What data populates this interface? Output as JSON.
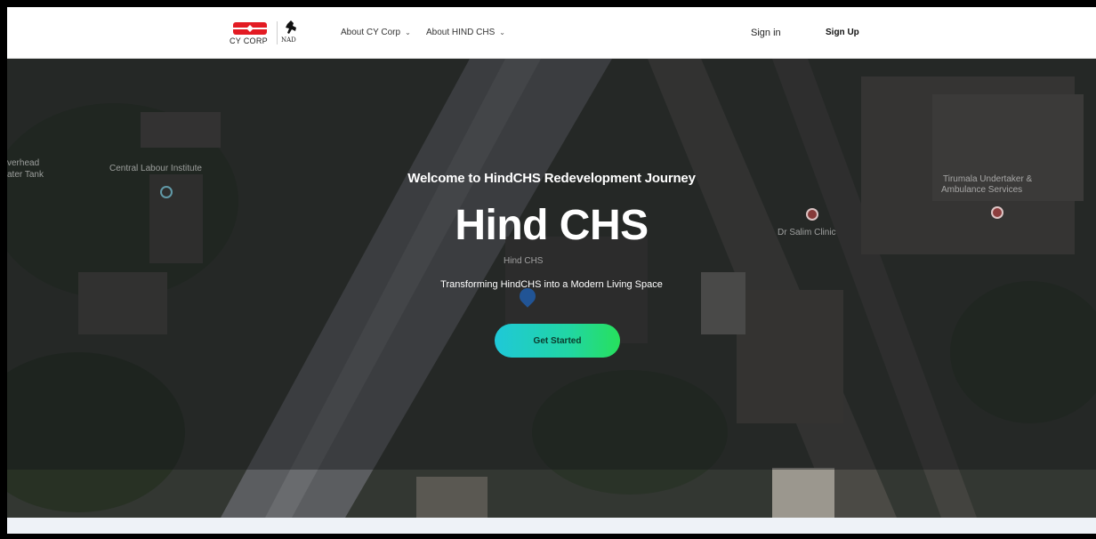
{
  "header": {
    "logo_cy_text": "CY CORP",
    "logo_nad_text": "NAD",
    "nav": [
      {
        "label": "About CY Corp",
        "chevron": "⌄"
      },
      {
        "label": "About HIND CHS",
        "chevron": "⌄"
      }
    ],
    "sign_in": "Sign in",
    "sign_up": "Sign Up"
  },
  "hero": {
    "welcome": "Welcome to HindCHS Redevelopment Journey",
    "title": "Hind CHS",
    "subtitle": "Transforming HindCHS into a Modern Living Space",
    "cta": "Get Started",
    "map_labels": {
      "central_labour": "Central Labour Institute",
      "overhead_1": "verhead",
      "overhead_2": "ater Tank",
      "hind_chs": "Hind CHS",
      "dr_salim": "Dr Salim Clinic",
      "tirumala_1": "Tirumala Undertaker &",
      "tirumala_2": "Ambulance Services"
    }
  },
  "colors": {
    "brand_red": "#e31b23",
    "cta_start": "#1fc8d8",
    "cta_end": "#27e05c",
    "overlay": "#14161a"
  },
  "icons": {
    "chevron": "chevron-down-icon",
    "pin": "map-pin-icon"
  }
}
